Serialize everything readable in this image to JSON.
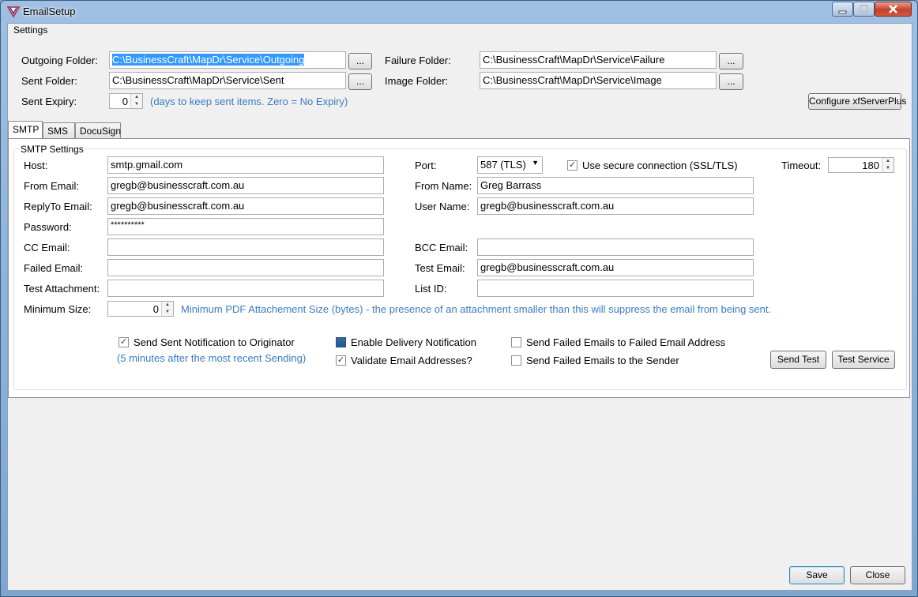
{
  "window": {
    "title": "EmailSetup"
  },
  "settings": {
    "group_title": "Settings",
    "outgoing_folder_label": "Outgoing Folder:",
    "outgoing_folder_value": "C:\\BusinessCraft\\MapDr\\Service\\Outgoing",
    "sent_folder_label": "Sent Folder:",
    "sent_folder_value": "C:\\BusinessCraft\\MapDr\\Service\\Sent",
    "sent_expiry_label": "Sent Expiry:",
    "sent_expiry_value": "0",
    "sent_expiry_hint": "(days to keep sent items. Zero = No Expiry)",
    "failure_folder_label": "Failure Folder:",
    "failure_folder_value": "C:\\BusinessCraft\\MapDr\\Service\\Failure",
    "image_folder_label": "Image Folder:",
    "image_folder_value": "C:\\BusinessCraft\\MapDr\\Service\\Image",
    "browse_label": "...",
    "configure_label": "Configure xfServerPlus"
  },
  "tabs": [
    {
      "label": "SMTP"
    },
    {
      "label": "SMS"
    },
    {
      "label": "DocuSign"
    }
  ],
  "smtp": {
    "group_title": "SMTP Settings",
    "host_label": "Host:",
    "host_value": "smtp.gmail.com",
    "from_email_label": "From Email:",
    "from_email_value": "gregb@businesscraft.com.au",
    "replyto_label": "ReplyTo Email:",
    "replyto_value": "gregb@businesscraft.com.au",
    "password_label": "Password:",
    "password_value": "**********",
    "cc_label": "CC Email:",
    "cc_value": "",
    "failed_label": "Failed Email:",
    "failed_value": "",
    "attachment_label": "Test Attachment:",
    "attachment_value": "",
    "min_size_label": "Minimum Size:",
    "min_size_value": "0",
    "min_size_hint": "Minimum PDF Attachement Size (bytes) - the presence of an attachment smaller than this will suppress the email from being sent.",
    "port_label": "Port:",
    "port_value": "587 (TLS)",
    "secure_label": "Use secure connection (SSL/TLS)",
    "timeout_label": "Timeout:",
    "timeout_value": "180",
    "from_name_label": "From Name:",
    "from_name_value": "Greg Barrass",
    "username_label": "User Name:",
    "username_value": "gregb@businesscraft.com.au",
    "bcc_label": "BCC Email:",
    "bcc_value": "",
    "test_email_label": "Test Email:",
    "test_email_value": "gregb@businesscraft.com.au",
    "list_id_label": "List ID:",
    "list_id_value": "",
    "send_notification_label": "Send Sent Notification to Originator",
    "send_notification_hint": "(5 minutes after the most recent Sending)",
    "delivery_label": "Enable Delivery Notification",
    "validate_label": "Validate Email Addresses?",
    "failed_to_failed_label": "Send Failed Emails to Failed Email Address",
    "failed_to_sender_label": "Send Failed Emails to the Sender",
    "send_test_label": "Send Test",
    "test_service_label": "Test Service"
  },
  "footer": {
    "save_label": "Save",
    "close_label": "Close"
  }
}
